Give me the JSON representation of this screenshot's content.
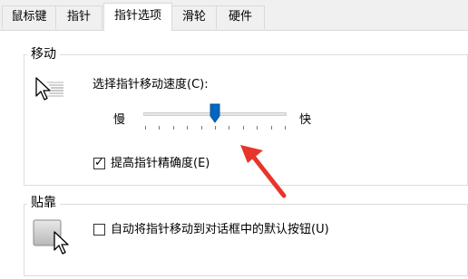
{
  "tabs": [
    {
      "label": "鼠标键",
      "active": false
    },
    {
      "label": "指针",
      "active": false
    },
    {
      "label": "指针选项",
      "active": true
    },
    {
      "label": "滑轮",
      "active": false
    },
    {
      "label": "硬件",
      "active": false
    }
  ],
  "motion": {
    "title": "移动",
    "speed_label": "选择指针移动速度(C):",
    "slow_label": "慢",
    "fast_label": "快",
    "speed_value": 6,
    "speed_max": 11,
    "enhance_precision_label": "提高指针精确度(E)",
    "enhance_precision_checked": true
  },
  "snap_to": {
    "title": "贴靠",
    "auto_move_label": "自动将指针移动到对话框中的默认按钮(U)",
    "auto_move_checked": false
  },
  "colors": {
    "accent": "#0067c0",
    "annotation_arrow": "#e8352b"
  }
}
